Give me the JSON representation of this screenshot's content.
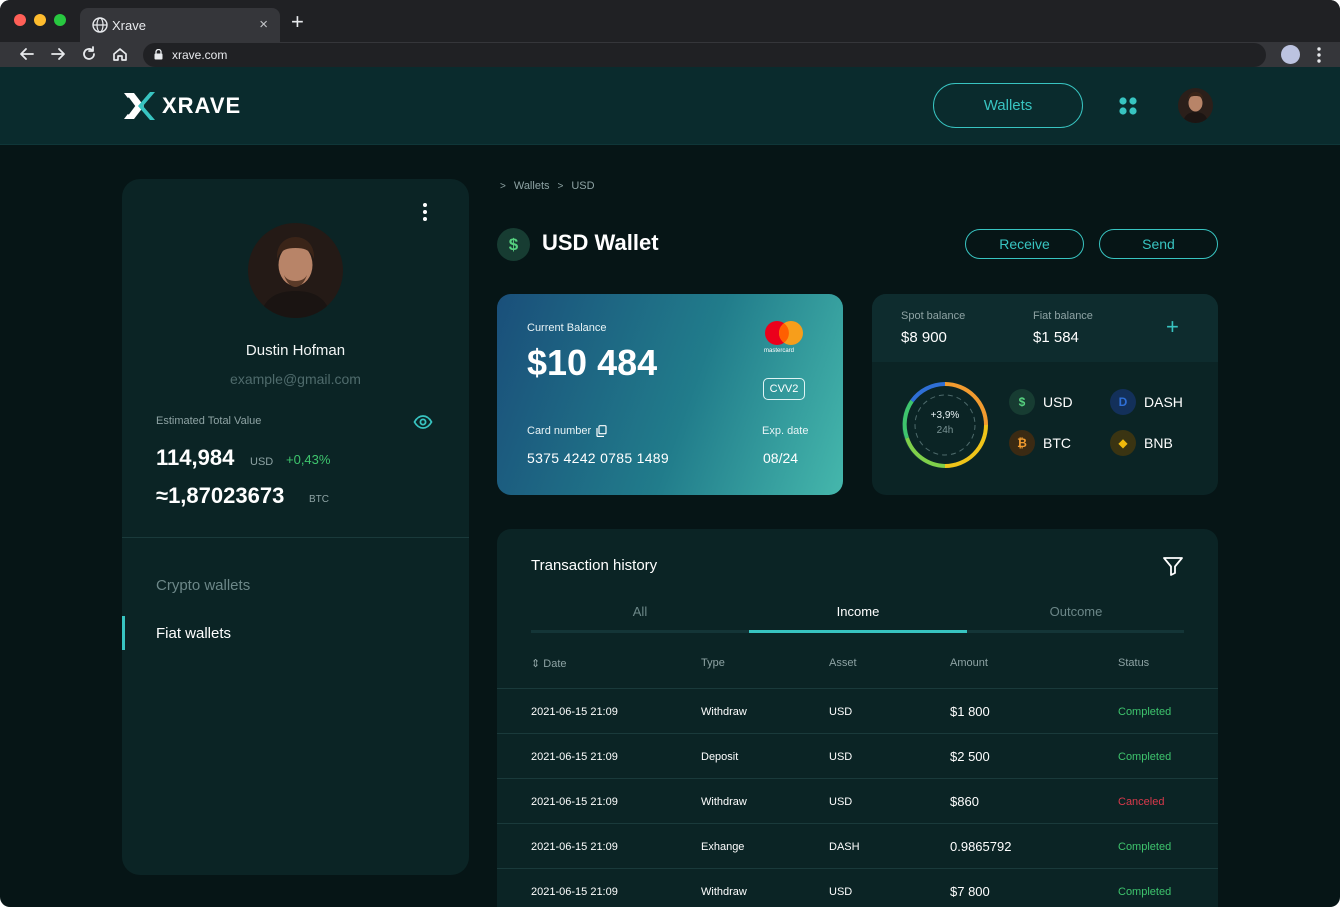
{
  "browser": {
    "tab_title": "Xrave",
    "tab_close": "×",
    "new_tab": "+",
    "url": "xrave.com"
  },
  "header": {
    "logo_text": "XRAVE",
    "wallets_label": "Wallets"
  },
  "profile": {
    "name": "Dustin Hofman",
    "email": "example@gmail.com",
    "estimated_label": "Estimated Total Value",
    "total_value": "114,984",
    "total_currency": "USD",
    "total_change": "+0,43%",
    "btc_value": "≈1,87023673",
    "btc_currency": "BTC"
  },
  "sidebar": {
    "items": [
      {
        "label": "Crypto wallets",
        "active": false
      },
      {
        "label": "Fiat wallets",
        "active": true
      }
    ]
  },
  "breadcrumb": {
    "items": [
      "Wallets",
      "USD"
    ]
  },
  "page": {
    "icon_symbol": "$",
    "title": "USD Wallet",
    "receive_label": "Receive",
    "send_label": "Send"
  },
  "card": {
    "balance_label": "Current Balance",
    "balance": "$10 484",
    "brand_text": "mastercard",
    "cvv_label": "CVV2",
    "card_number_label": "Card number",
    "card_number": "5375 4242 0785 1489",
    "exp_label": "Exp. date",
    "exp_value": "08/24"
  },
  "balances": {
    "spot_label": "Spot balance",
    "spot_value": "$8 900",
    "fiat_label": "Fiat balance",
    "fiat_value": "$1 584",
    "add_symbol": "+",
    "change": "+3,9%",
    "period": "24h",
    "coins": [
      {
        "name": "USD",
        "symbol": "$",
        "color": "#56d17f",
        "bg": "#173c32"
      },
      {
        "name": "DASH",
        "symbol": "D",
        "color": "#2f6fd6",
        "bg": "#13305a"
      },
      {
        "name": "BTC",
        "symbol": "₿",
        "color": "#f29b2f",
        "bg": "#3b2a13"
      },
      {
        "name": "BNB",
        "symbol": "◆",
        "color": "#f0b90b",
        "bg": "#3a3412"
      }
    ]
  },
  "transactions": {
    "title": "Transaction history",
    "tabs": [
      "All",
      "Income",
      "Outcome"
    ],
    "active_tab": "Income",
    "columns": [
      "Date",
      "Type",
      "Asset",
      "Amount",
      "Status"
    ],
    "rows": [
      {
        "date": "2021-06-15 21:09",
        "type": "Withdraw",
        "asset": "USD",
        "amount": "$1 800",
        "status": "Completed"
      },
      {
        "date": "2021-06-15 21:09",
        "type": "Deposit",
        "asset": "USD",
        "amount": "$2 500",
        "status": "Completed"
      },
      {
        "date": "2021-06-15 21:09",
        "type": "Withdraw",
        "asset": "USD",
        "amount": "$860",
        "status": "Canceled"
      },
      {
        "date": "2021-06-15 21:09",
        "type": "Exhange",
        "asset": "DASH",
        "amount": "0.9865792",
        "status": "Completed"
      },
      {
        "date": "2021-06-15 21:09",
        "type": "Withdraw",
        "asset": "USD",
        "amount": "$7 800",
        "status": "Completed"
      }
    ]
  },
  "colors": {
    "accent": "#38c4c1",
    "success": "#3ec46d",
    "danger": "#d8394b",
    "background": "#061516"
  }
}
